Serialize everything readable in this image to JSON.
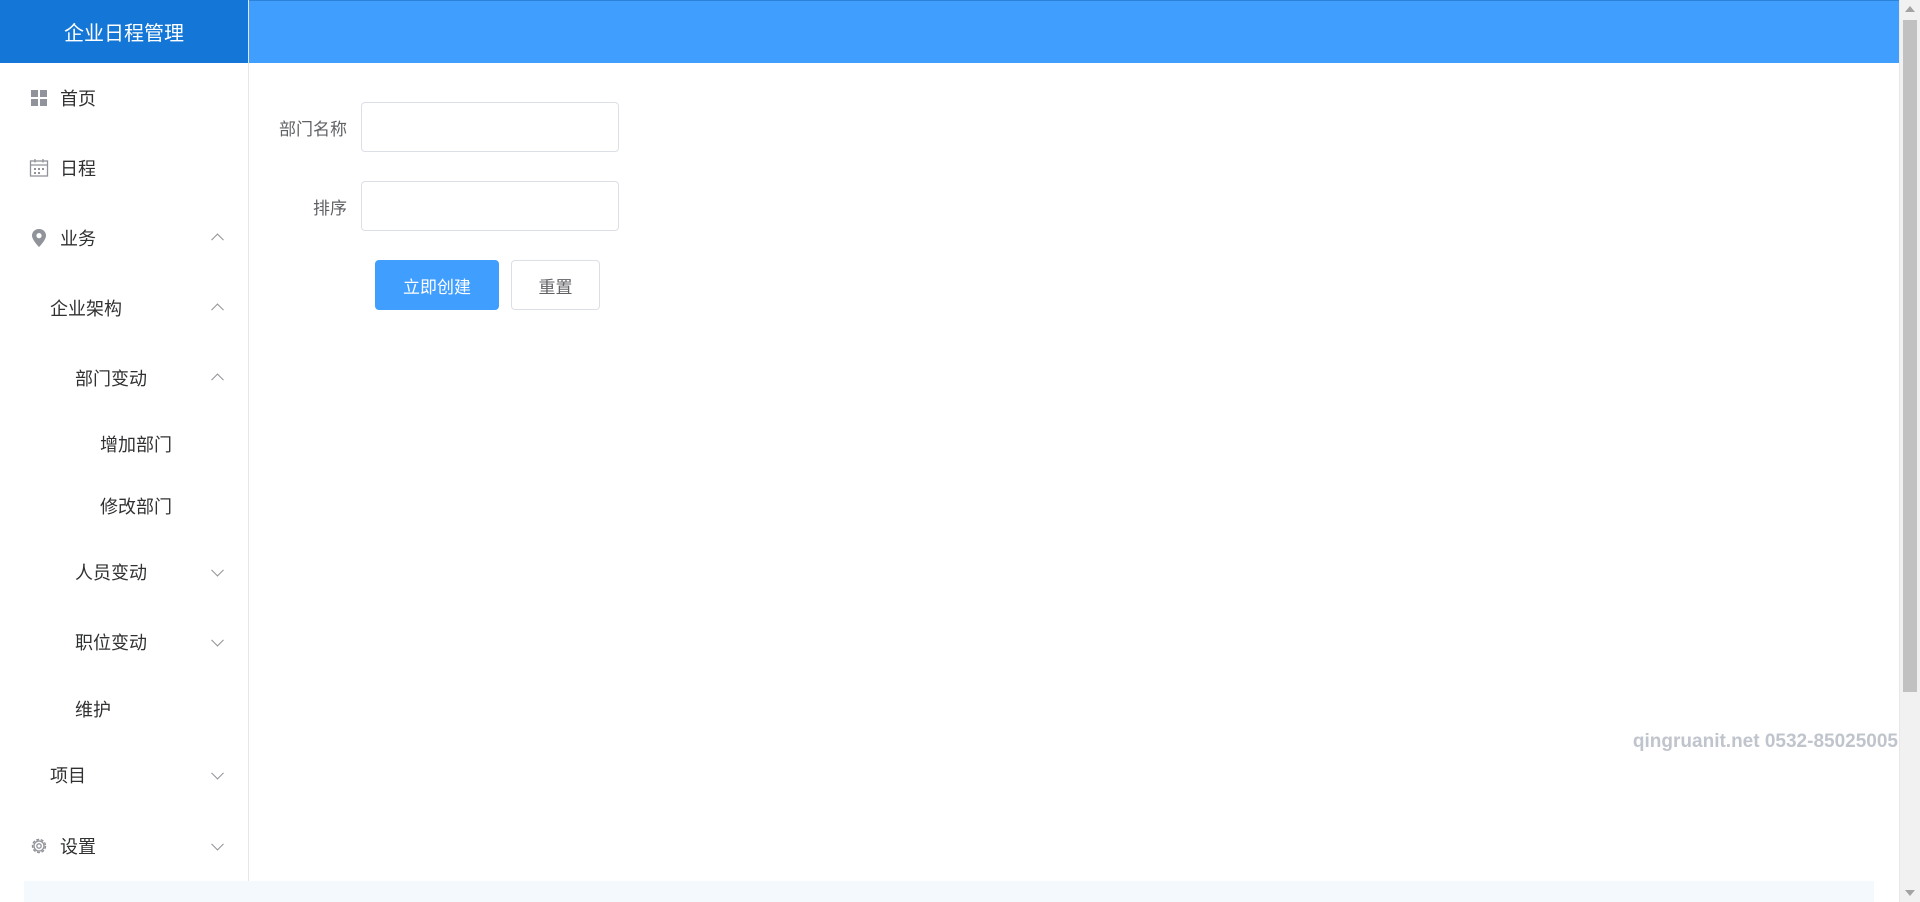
{
  "app": {
    "title": "企业日程管理"
  },
  "sidebar": {
    "items": [
      {
        "label": "首页",
        "icon": "grid-icon"
      },
      {
        "label": "日程",
        "icon": "calendar-icon"
      },
      {
        "label": "业务",
        "icon": "location-icon",
        "expanded": true
      },
      {
        "label": "企业架构",
        "expanded": true
      },
      {
        "label": "部门变动",
        "expanded": true
      },
      {
        "label": "增加部门"
      },
      {
        "label": "修改部门"
      },
      {
        "label": "人员变动",
        "expanded": false
      },
      {
        "label": "职位变动",
        "expanded": false
      },
      {
        "label": "维护"
      },
      {
        "label": "项目",
        "expanded": false
      },
      {
        "label": "设置",
        "icon": "gear-icon",
        "expanded": false
      }
    ]
  },
  "form": {
    "dept_name_label": "部门名称",
    "dept_name_value": "",
    "sort_label": "排序",
    "sort_value": "",
    "submit_label": "立即创建",
    "reset_label": "重置"
  },
  "watermark": "qingruanit.net 0532-85025005",
  "colors": {
    "header": "#409eff",
    "logo_bg": "#1476d6",
    "primary_button": "#409eff"
  }
}
